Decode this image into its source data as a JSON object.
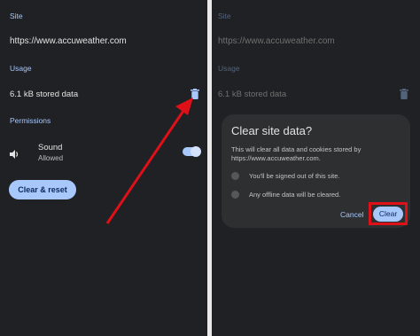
{
  "left_screen": {
    "site_heading": "Site",
    "url": "https://www.accuweather.com",
    "usage_heading": "Usage",
    "stored_data": "6.1 kB stored data",
    "permissions_heading": "Permissions",
    "sound_label": "Sound",
    "sound_status": "Allowed",
    "clear_reset_label": "Clear & reset"
  },
  "right_screen": {
    "site_heading": "Site",
    "url": "https://www.accuweather.com",
    "usage_heading": "Usage",
    "stored_data": "6.1 kB stored data"
  },
  "dialog": {
    "title": "Clear site data?",
    "body": "This will clear all data and cookies stored by https://www.accuweather.com.",
    "item1": "You'll be signed out of this site.",
    "item2": "Any offline data will be cleared.",
    "cancel_label": "Cancel",
    "clear_label": "Clear"
  },
  "colors": {
    "background": "#202124",
    "accent": "#a8c7fa",
    "annotation": "#e01018"
  },
  "icons": [
    "trash-icon",
    "speaker-icon",
    "toggle-switch",
    "circle-icon"
  ]
}
